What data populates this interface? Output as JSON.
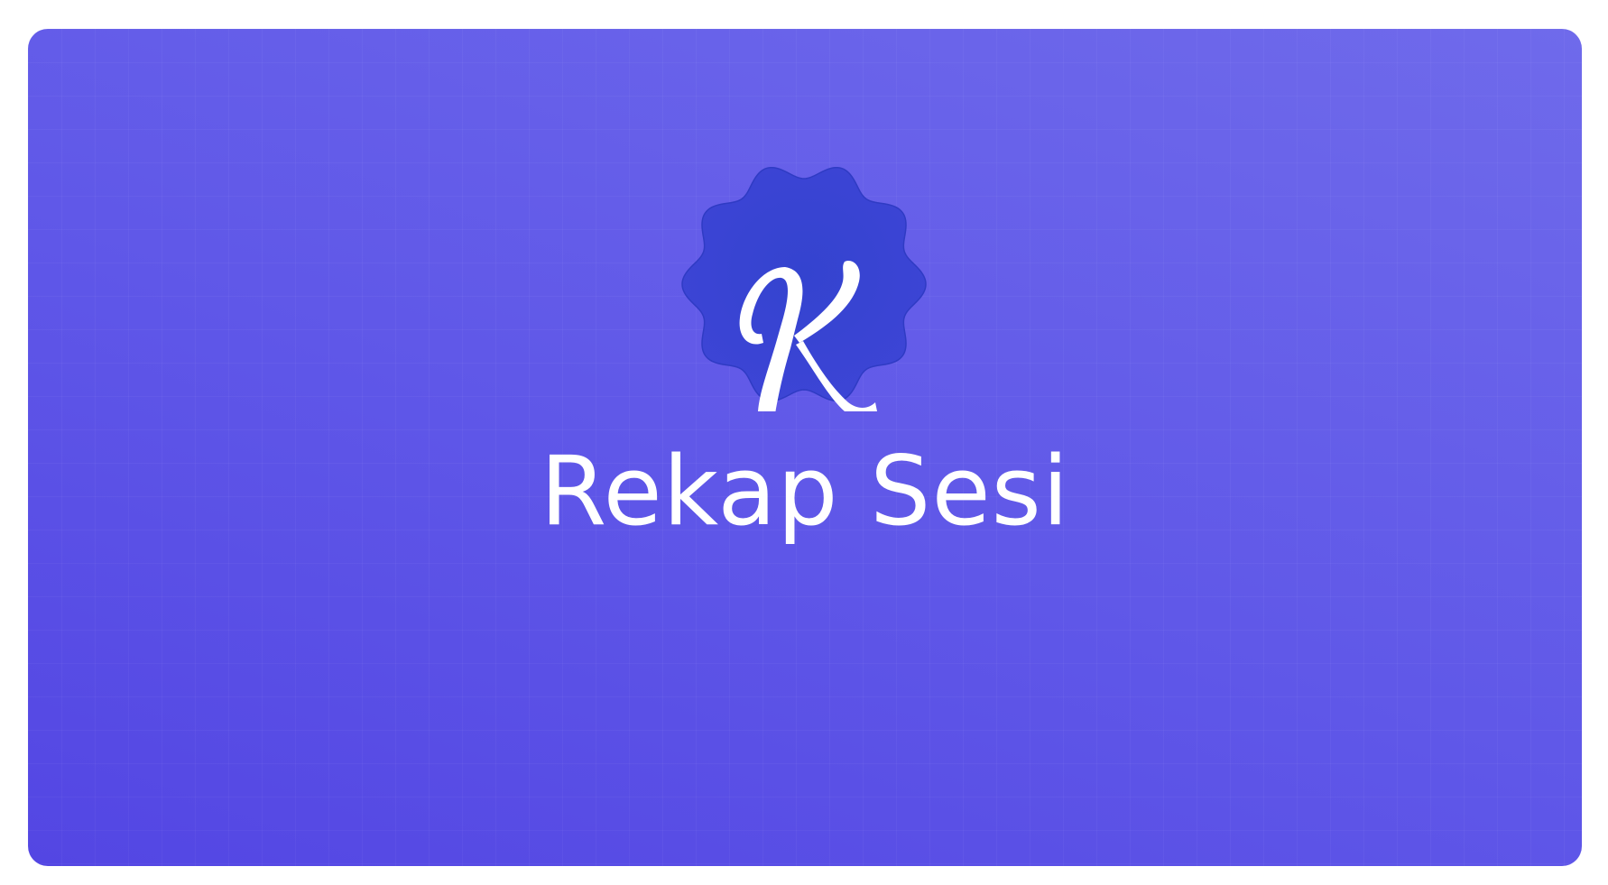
{
  "app": {
    "logo_icon": "k-badge-icon",
    "title": "Rekap Sesi"
  },
  "colors": {
    "background_start": "#5346e3",
    "background_end": "#6f6aeb",
    "badge_fill": "#3a43d3",
    "text": "#ffffff"
  }
}
